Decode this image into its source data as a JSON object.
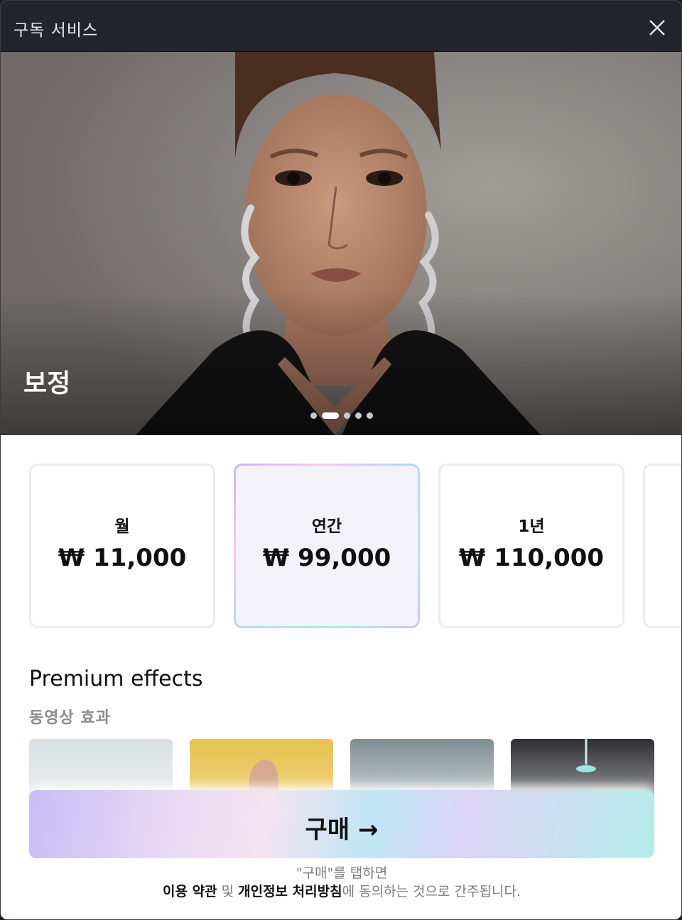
{
  "window": {
    "title": "구독 서비스"
  },
  "hero": {
    "label": "보정",
    "slide_count": 5,
    "active_slide": 2
  },
  "plans": [
    {
      "name": "월",
      "price": "₩ 11,000",
      "selected": false
    },
    {
      "name": "연간",
      "price": "₩ 99,000",
      "selected": true
    },
    {
      "name": "1년",
      "price": "₩ 110,000",
      "selected": false
    }
  ],
  "section": {
    "title": "Premium effects",
    "subtitle": "동영상 효과"
  },
  "buy_button": {
    "label": "구매 →"
  },
  "legal": {
    "line1": "\"구매\"를 탭하면",
    "terms_link": "이용 약관",
    "and": " 및 ",
    "privacy_link": "개인정보 처리방침",
    "suffix": "에 동의하는 것으로 간주됩니다."
  },
  "colors": {
    "titlebar": "#23242c",
    "selected_card_bg": "#f4f2f9",
    "card_border": "#ececee"
  }
}
